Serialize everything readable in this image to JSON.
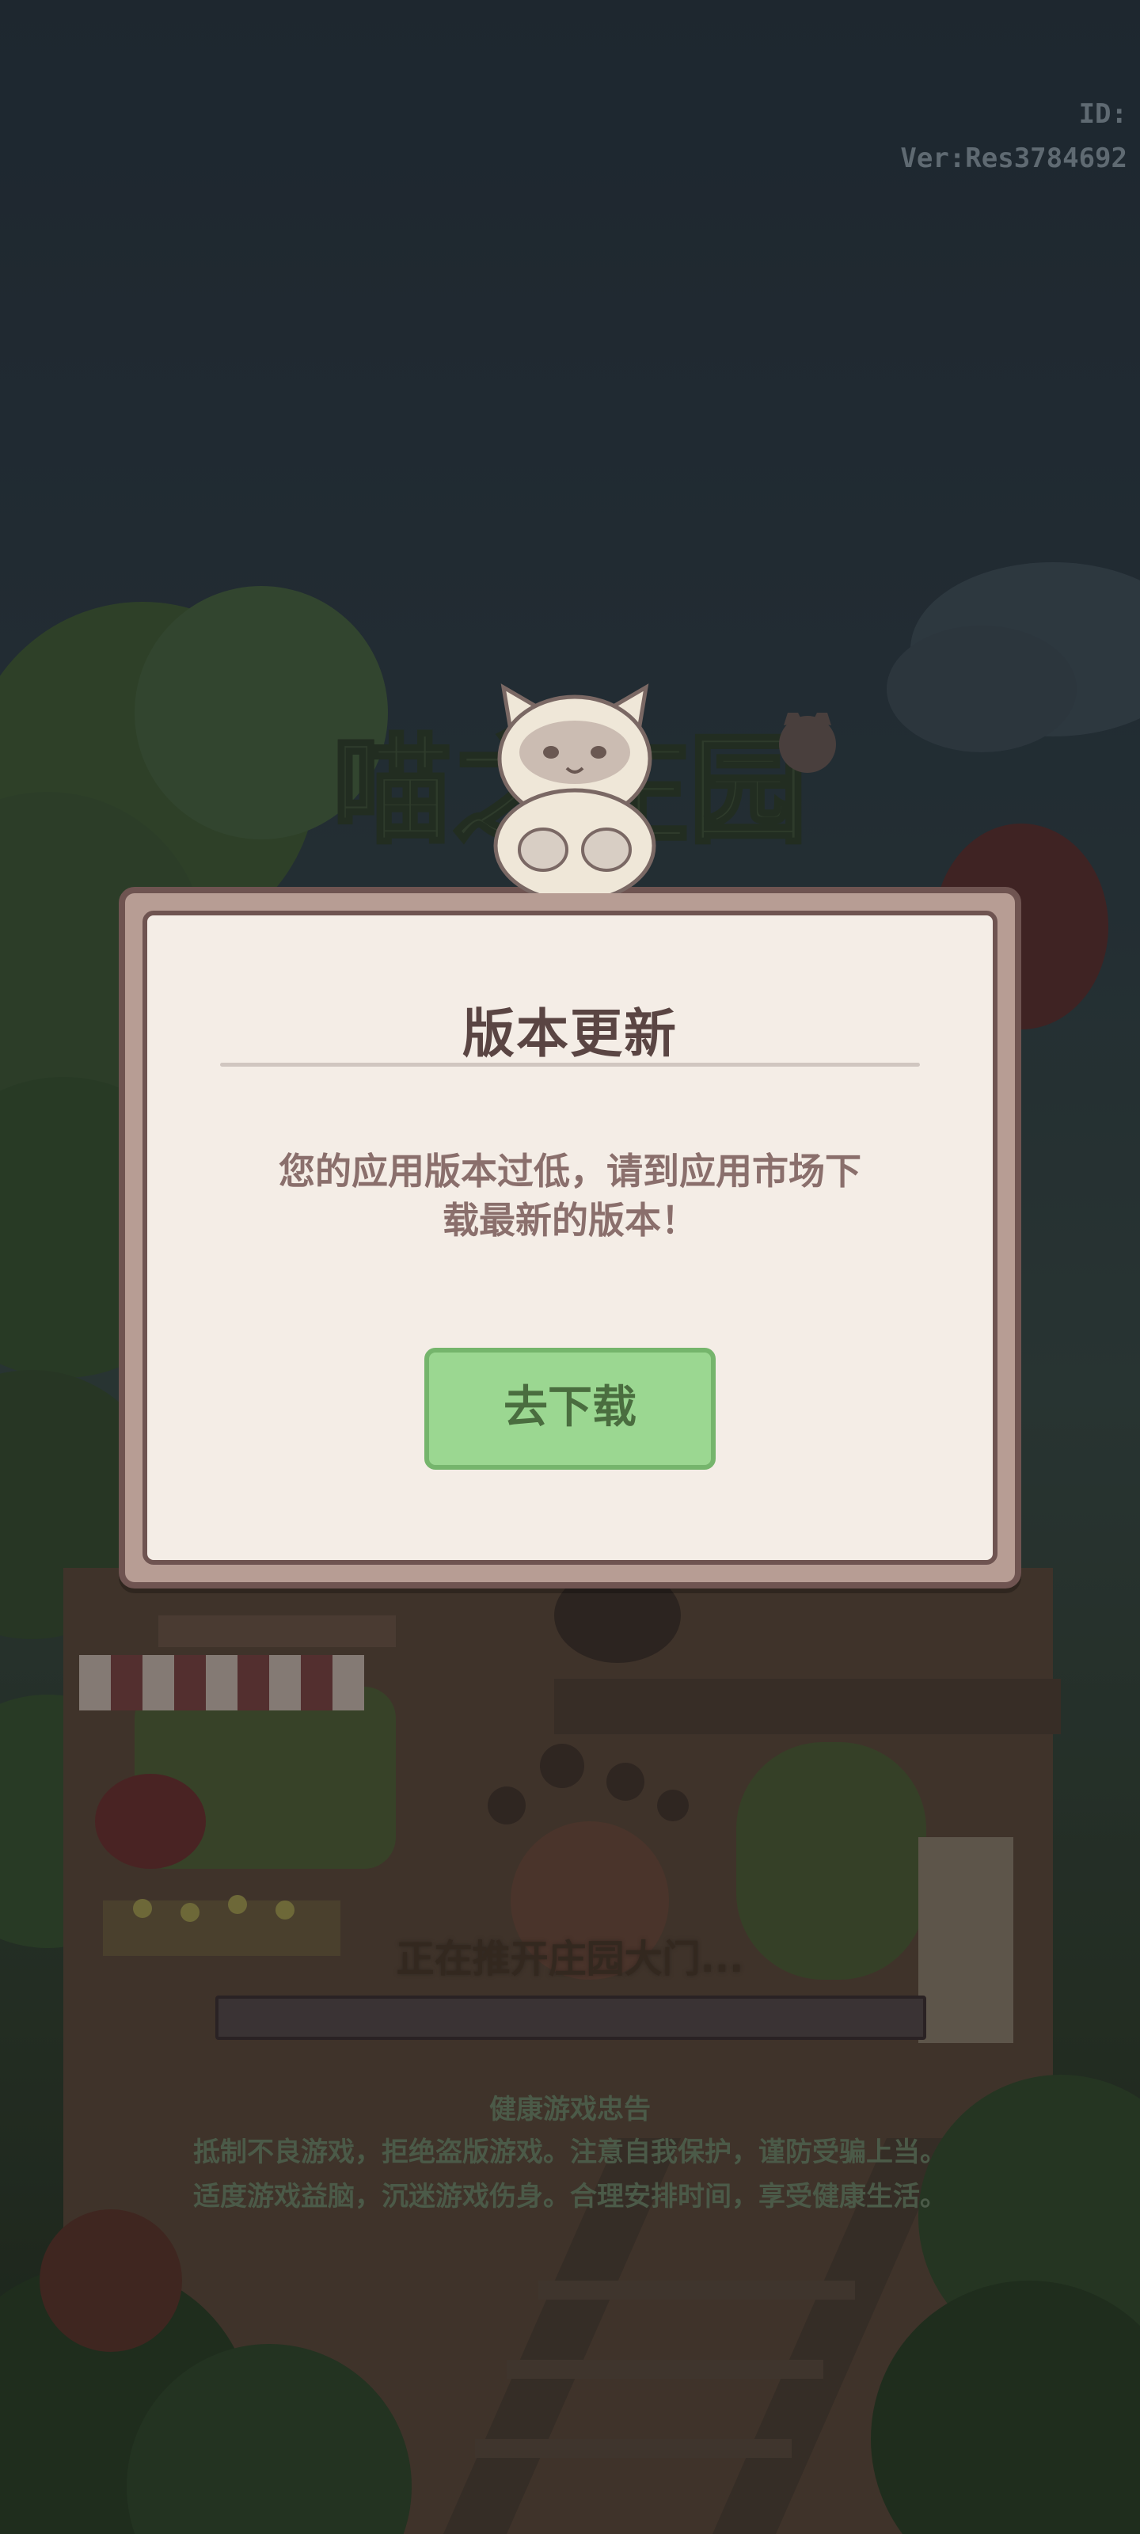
{
  "version": {
    "id_label": "ID:",
    "ver_label": "Ver:Res3784692"
  },
  "logo": {
    "title": "喵之庄园"
  },
  "dialog": {
    "title": "版本更新",
    "message_line1": "您的应用版本过低，请到应用市场下",
    "message_line2": "载最新的版本！",
    "download_button": "去下载"
  },
  "loading": {
    "text": "正在推开庄园大门...",
    "progress": 0
  },
  "health_notice": {
    "title": "健康游戏忠告",
    "line1": "抵制不良游戏，拒绝盗版游戏。注意自我保护，谨防受骗上当。",
    "line2": "适度游戏益脑，沉迷游戏伤身。合理安排时间，享受健康生活。"
  },
  "colors": {
    "dialog_bg": "#f4ede6",
    "dialog_border": "#6f5451",
    "button_green": "#9bd791",
    "button_text": "#4a6d3f"
  }
}
